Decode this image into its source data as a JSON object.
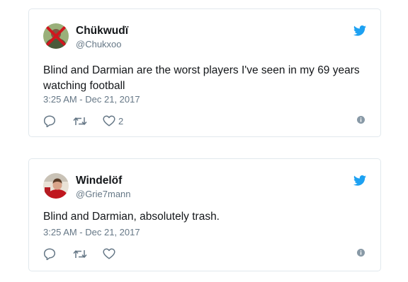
{
  "tweets": [
    {
      "name": "Chükwudï",
      "handle": "@Chukxoo",
      "text": "Blind and Darmian are the worst players I've seen in my 69 years watching football",
      "time": "3:25 AM - Dec 21, 2017",
      "likes": "2"
    },
    {
      "name": "Windelöf",
      "handle": "@Grie7mann",
      "text": "Blind and Darmian, absolutely trash.",
      "time": "3:25 AM - Dec 21, 2017",
      "likes": ""
    }
  ],
  "colors": {
    "twitter_blue": "#1da1f2",
    "text": "#14171a",
    "muted": "#657786",
    "border": "#e1e8ed"
  },
  "icons": [
    "twitter-bird-icon",
    "reply-icon",
    "retweet-icon",
    "heart-icon",
    "info-icon"
  ]
}
